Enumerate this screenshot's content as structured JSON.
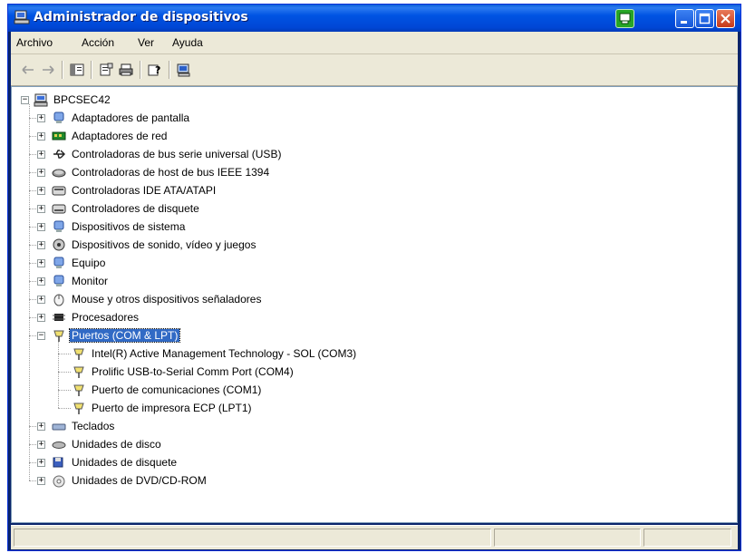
{
  "window": {
    "title": "Administrador de dispositivos"
  },
  "menu": [
    "Archivo",
    "Acción",
    "Ver",
    "Ayuda"
  ],
  "toolbar": {
    "buttons": [
      "back-arrow-icon",
      "forward-arrow-icon",
      "show-hide-tree-icon",
      "properties-icon",
      "print-icon",
      "help-icon",
      "update-driver-icon"
    ]
  },
  "tree": {
    "root": "BPCSEC42",
    "categories": [
      {
        "label": "Adaptadores de pantalla",
        "icon": "display-adapter-icon"
      },
      {
        "label": "Adaptadores de red",
        "icon": "network-adapter-icon"
      },
      {
        "label": "Controladoras de bus serie universal (USB)",
        "icon": "usb-icon"
      },
      {
        "label": "Controladoras de host de bus IEEE 1394",
        "icon": "firewire-icon"
      },
      {
        "label": "Controladoras IDE ATA/ATAPI",
        "icon": "ide-controller-icon"
      },
      {
        "label": "Controladores de disquete",
        "icon": "floppy-controller-icon"
      },
      {
        "label": "Dispositivos de sistema",
        "icon": "system-device-icon"
      },
      {
        "label": "Dispositivos de sonido, vídeo y juegos",
        "icon": "sound-icon"
      },
      {
        "label": "Equipo",
        "icon": "computer-icon"
      },
      {
        "label": "Monitor",
        "icon": "monitor-icon"
      },
      {
        "label": "Mouse y otros dispositivos señaladores",
        "icon": "mouse-icon"
      },
      {
        "label": "Procesadores",
        "icon": "processor-icon"
      },
      {
        "label": "Puertos (COM & LPT)",
        "icon": "port-icon",
        "expanded": true,
        "selected": true,
        "children": [
          "Intel(R) Active Management Technology - SOL (COM3)",
          "Prolific USB-to-Serial Comm Port (COM4)",
          "Puerto de comunicaciones (COM1)",
          "Puerto de impresora ECP (LPT1)"
        ]
      },
      {
        "label": "Teclados",
        "icon": "keyboard-icon"
      },
      {
        "label": "Unidades de disco",
        "icon": "disk-drive-icon"
      },
      {
        "label": "Unidades de disquete",
        "icon": "floppy-drive-icon"
      },
      {
        "label": "Unidades de DVD/CD-ROM",
        "icon": "dvd-drive-icon"
      }
    ]
  },
  "colors": {
    "titlebar": "#0054e3",
    "selection": "#316ac5",
    "chrome": "#ece9d8"
  }
}
